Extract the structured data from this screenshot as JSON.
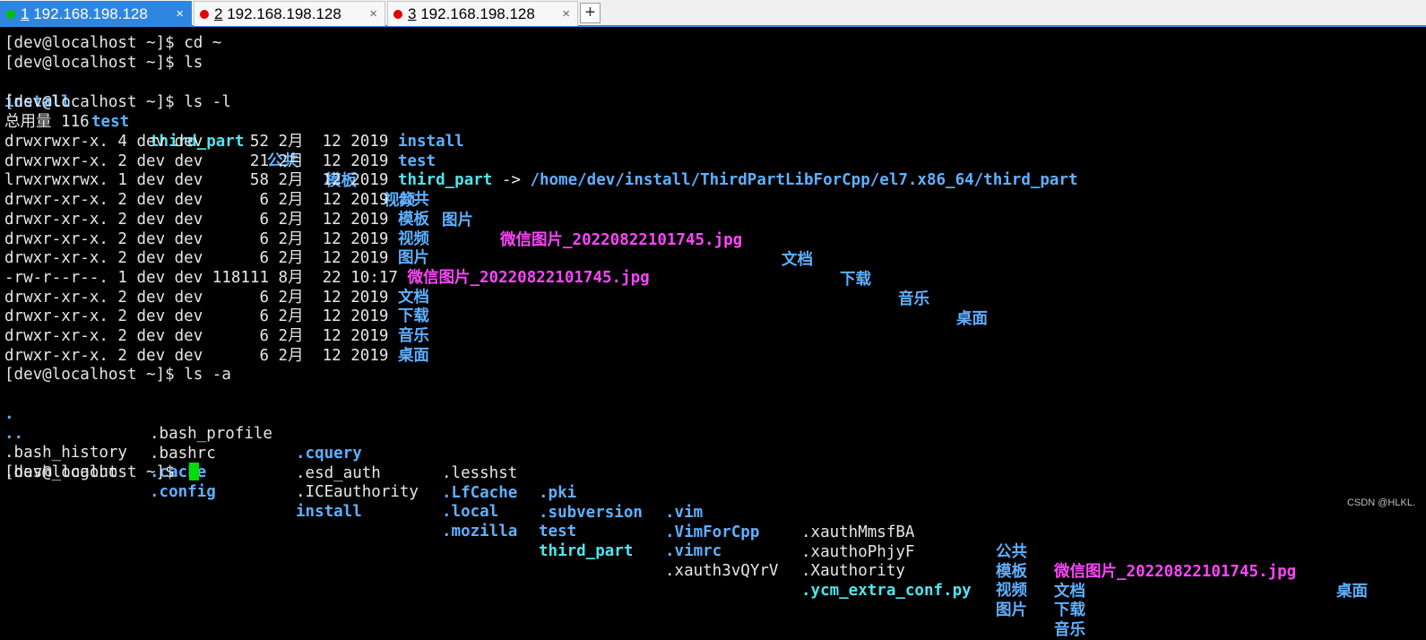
{
  "tabs": [
    {
      "num": "1",
      "host": "192.168.198.128",
      "dot_color": "#00c000",
      "active": true
    },
    {
      "num": "2",
      "host": "192.168.198.128",
      "dot_color": "#e00000",
      "active": false
    },
    {
      "num": "3",
      "host": "192.168.198.128",
      "dot_color": "#e00000",
      "active": false
    }
  ],
  "tab_close_glyph": "×",
  "new_tab_glyph": "+",
  "prompt": "[dev@localhost ~]$ ",
  "commands": {
    "cd": "cd ~",
    "ls": "ls",
    "ls_l": "ls -l",
    "ls_a": "ls -a"
  },
  "ls_output": {
    "dirs": [
      "install",
      "test"
    ],
    "link": "third_part",
    "zh_dirs_1": [
      "公共",
      "模板",
      "视频",
      "图片"
    ],
    "image": "微信图片_20220822101745.jpg",
    "zh_dirs_2": [
      "文档",
      "下载",
      "音乐",
      "桌面"
    ]
  },
  "ls_l": {
    "total": "总用量 116",
    "rows": [
      {
        "meta": "drwxrwxr-x. 4 dev dev     52 2月  12 2019 ",
        "name": "install",
        "kind": "dir"
      },
      {
        "meta": "drwxrwxr-x. 2 dev dev     21 2月  12 2019 ",
        "name": "test",
        "kind": "dir"
      },
      {
        "meta": "lrwxrwxrwx. 1 dev dev     58 2月  12 2019 ",
        "name": "third_part",
        "kind": "link",
        "arrow": " -> ",
        "target": "/home/dev/install/ThirdPartLibForCpp/el7.x86_64/third_part"
      },
      {
        "meta": "drwxr-xr-x. 2 dev dev      6 2月  12 2019 ",
        "name": "公共",
        "kind": "dir"
      },
      {
        "meta": "drwxr-xr-x. 2 dev dev      6 2月  12 2019 ",
        "name": "模板",
        "kind": "dir"
      },
      {
        "meta": "drwxr-xr-x. 2 dev dev      6 2月  12 2019 ",
        "name": "视频",
        "kind": "dir"
      },
      {
        "meta": "drwxr-xr-x. 2 dev dev      6 2月  12 2019 ",
        "name": "图片",
        "kind": "dir"
      },
      {
        "meta": "-rw-r--r--. 1 dev dev 118111 8月  22 10:17 ",
        "name": "微信图片_20220822101745.jpg",
        "kind": "image"
      },
      {
        "meta": "drwxr-xr-x. 2 dev dev      6 2月  12 2019 ",
        "name": "文档",
        "kind": "dir"
      },
      {
        "meta": "drwxr-xr-x. 2 dev dev      6 2月  12 2019 ",
        "name": "下载",
        "kind": "dir"
      },
      {
        "meta": "drwxr-xr-x. 2 dev dev      6 2月  12 2019 ",
        "name": "音乐",
        "kind": "dir"
      },
      {
        "meta": "drwxr-xr-x. 2 dev dev      6 2月  12 2019 ",
        "name": "桌面",
        "kind": "dir"
      }
    ]
  },
  "ls_a": {
    "rows": [
      [
        {
          "t": ".",
          "k": "dir"
        },
        {
          "t": ".bash_profile",
          "k": "plain"
        },
        {
          "t": ".cquery",
          "k": "dir"
        },
        {
          "t": ".lesshst",
          "k": "plain"
        },
        {
          "t": ".pki",
          "k": "dir"
        },
        {
          "t": ".vim",
          "k": "dir"
        },
        {
          "t": ".xauthMmsfBA",
          "k": "plain"
        },
        {
          "t": "公共",
          "k": "dir"
        },
        {
          "t": "微信图片_20220822101745.jpg",
          "k": "image"
        },
        {
          "t": "桌面",
          "k": "dir"
        }
      ],
      [
        {
          "t": "..",
          "k": "dir"
        },
        {
          "t": ".bashrc",
          "k": "plain"
        },
        {
          "t": ".esd_auth",
          "k": "plain"
        },
        {
          "t": ".LfCache",
          "k": "dir"
        },
        {
          "t": ".subversion",
          "k": "dir"
        },
        {
          "t": ".VimForCpp",
          "k": "dir"
        },
        {
          "t": ".xauthoPhjyF",
          "k": "plain"
        },
        {
          "t": "模板",
          "k": "dir"
        },
        {
          "t": "文档",
          "k": "dir"
        }
      ],
      [
        {
          "t": ".bash_history",
          "k": "plain"
        },
        {
          "t": ".cache",
          "k": "dir"
        },
        {
          "t": ".ICEauthority",
          "k": "plain"
        },
        {
          "t": ".local",
          "k": "dir"
        },
        {
          "t": "test",
          "k": "dir"
        },
        {
          "t": ".vimrc",
          "k": "dir"
        },
        {
          "t": ".Xauthority",
          "k": "plain"
        },
        {
          "t": "视频",
          "k": "dir"
        },
        {
          "t": "下载",
          "k": "dir"
        }
      ],
      [
        {
          "t": ".bash_logout",
          "k": "plain"
        },
        {
          "t": ".config",
          "k": "dir"
        },
        {
          "t": "install",
          "k": "dir"
        },
        {
          "t": ".mozilla",
          "k": "dir"
        },
        {
          "t": "third_part",
          "k": "link"
        },
        {
          "t": ".xauth3vQYrV",
          "k": "plain"
        },
        {
          "t": ".ycm_extra_conf.py",
          "k": "link"
        },
        {
          "t": "图片",
          "k": "dir"
        },
        {
          "t": "音乐",
          "k": "dir"
        }
      ]
    ]
  },
  "watermark": "CSDN @HLKL.",
  "colors": {
    "dir": "#5fb0ff",
    "link": "#4ee6ee",
    "image": "#ff45ff",
    "cursor": "#00e000",
    "tab_active": "#2f86e0"
  }
}
